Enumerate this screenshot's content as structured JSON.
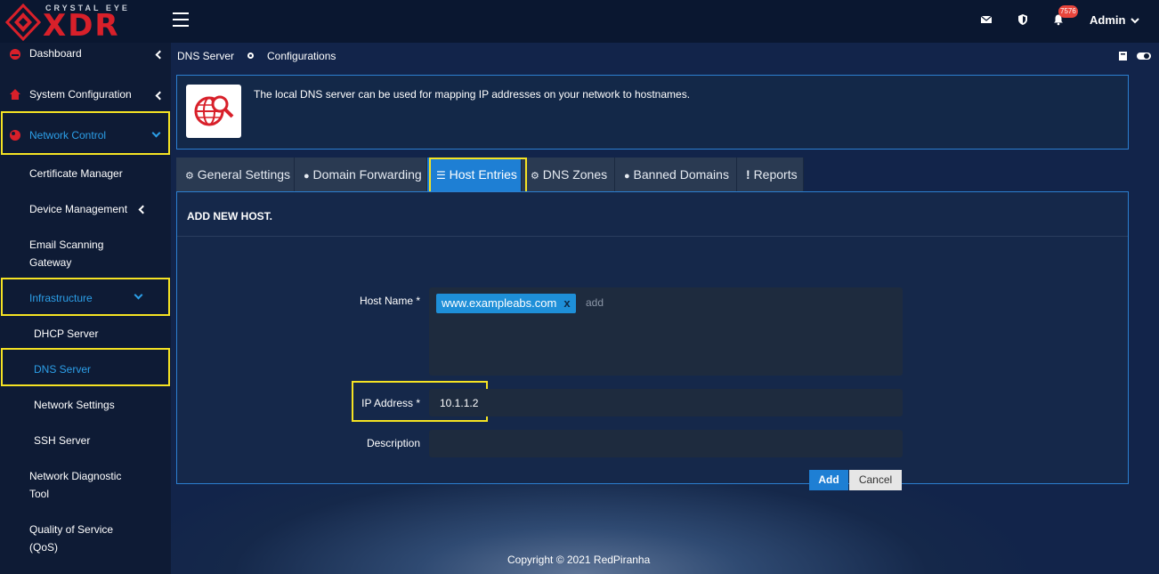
{
  "brand": {
    "top": "CRYSTAL EYE",
    "main": "XDR"
  },
  "topbar": {
    "notifications": "7576",
    "user": "Admin"
  },
  "sidebar": {
    "dashboard": "Dashboard",
    "system_configuration": "System Configuration",
    "network_control": "Network Control",
    "certificate_manager": "Certificate Manager",
    "device_management": "Device Management",
    "email_scanning_l1": "Email Scanning",
    "email_scanning_l2": "Gateway",
    "infrastructure": "Infrastructure",
    "dhcp_server": "DHCP Server",
    "dns_server": "DNS Server",
    "network_settings": "Network Settings",
    "ssh_server": "SSH Server",
    "network_diag_l1": "Network Diagnostic",
    "network_diag_l2": "Tool",
    "qos_l1": "Quality of Service",
    "qos_l2": "(QoS)"
  },
  "breadcrumb": {
    "section": "DNS Server",
    "page": "Configurations"
  },
  "info": {
    "text": "The local DNS server can be used for mapping IP addresses on your network to hostnames."
  },
  "tabs": {
    "general": "General Settings",
    "domain_forwarding": "Domain Forwarding",
    "host_entries": "Host Entries",
    "dns_zones": "DNS Zones",
    "banned_domains": "Banned Domains",
    "reports": "Reports"
  },
  "form": {
    "title": "ADD NEW HOST.",
    "host_name_label": "Host Name *",
    "host_tag": "www.exampleabs.com",
    "tag_remove": "x",
    "host_placeholder": "add",
    "ip_label": "IP Address *",
    "ip_value": "10.1.1.2",
    "description_label": "Description",
    "description_value": "",
    "add_button": "Add",
    "cancel_button": "Cancel"
  },
  "footer": {
    "copyright": "Copyright © 2021 RedPiranha"
  },
  "colors": {
    "accent": "#1e8fd8",
    "highlight": "#f5e323",
    "brand_red": "#d8202a"
  }
}
